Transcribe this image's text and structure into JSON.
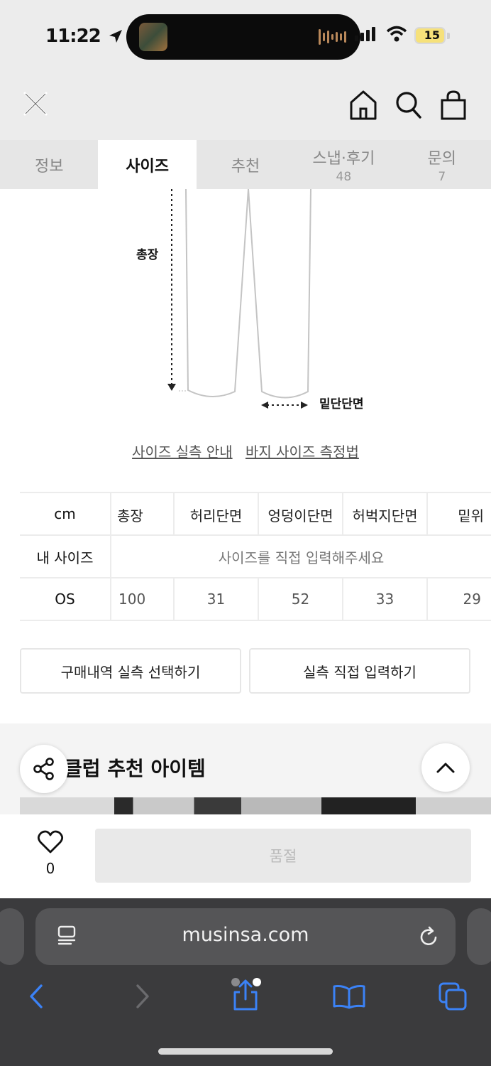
{
  "status": {
    "time": "11:22",
    "battery": "15"
  },
  "tabs": [
    {
      "label": "정보",
      "count": ""
    },
    {
      "label": "사이즈",
      "count": ""
    },
    {
      "label": "추천",
      "count": ""
    },
    {
      "label": "스냅·후기",
      "count": "48"
    },
    {
      "label": "문의",
      "count": "7"
    }
  ],
  "diagram": {
    "total_length_label": "총장",
    "hem_width_label": "밑단단면"
  },
  "guide_links": {
    "actual_size": "사이즈 실측 안내",
    "pants_measure": "바지 사이즈 측정법"
  },
  "size_table": {
    "headers": [
      "cm",
      "총장",
      "허리단면",
      "엉덩이단면",
      "허벅지단면",
      "밑위"
    ],
    "my_size_label": "내 사이즈",
    "my_size_placeholder": "사이즈를 직접 입력해주세요",
    "rows": [
      {
        "size": "OS",
        "values": [
          "100",
          "31",
          "52",
          "33",
          "29"
        ]
      }
    ]
  },
  "buttons": {
    "purchase_history": "구매내역 실측 선택하기",
    "direct_input": "실측 직접 입력하기"
  },
  "recommend": {
    "title": "클럽 추천 아이템"
  },
  "bottom_bar": {
    "like_count": "0",
    "soldout_label": "품절"
  },
  "browser": {
    "url": "musinsa.com"
  }
}
